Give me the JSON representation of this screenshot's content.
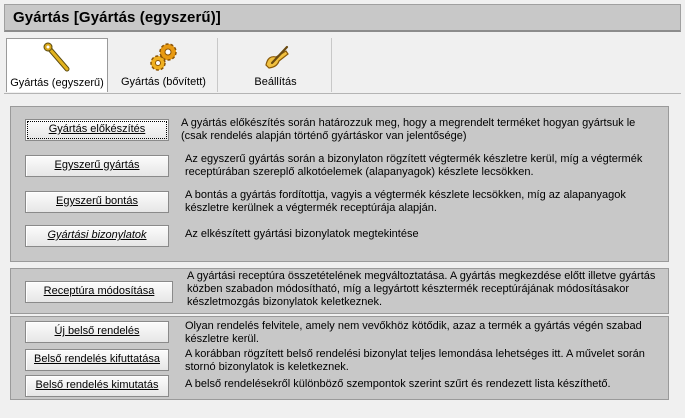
{
  "window": {
    "title": "Gyártás [Gyártás (egyszerű)]"
  },
  "tabs": [
    {
      "label": "Gyártás (egyszerű)",
      "icon": "wrench-icon"
    },
    {
      "label": "Gyártás (bővített)",
      "icon": "gears-icon"
    },
    {
      "label": "Beállítás",
      "icon": "hand-pen-icon"
    }
  ],
  "actions": {
    "prep": {
      "label": "Gyártás előkészítés",
      "desc": "A gyártás előkészítés során határozzuk meg, hogy a megrendelt terméket hogyan gyártsuk le (csak rendelés alapján történő gyártáskor van jelentősége)"
    },
    "simple": {
      "label": "Egyszerű gyártás",
      "desc": "Az egyszerű gyártás során a bizonylaton rögzített végtermék készletre kerül, míg a végtermék receptúrában szereplő alkotóelemek (alapanyagok) készlete lecsökken."
    },
    "breakdown": {
      "label": "Egyszerű bontás",
      "desc": "A bontás a gyártás fordítottja, vagyis a végtermék készlete lecsökken, míg az alapanyagok készletre kerülnek a végtermék receptúrája alapján."
    },
    "documents": {
      "label": "Gyártási bizonylatok",
      "desc": "Az elkészített gyártási bizonylatok megtekintése"
    },
    "recipe": {
      "label": "Receptúra módosítása",
      "desc": "A gyártási receptúra összetételének megváltoztatása. A gyártás megkezdése előtt illetve gyártás közben szabadon módosítható, míg a legyártott késztermék receptúrájának módosításakor készletmozgás bizonylatok keletkeznek."
    },
    "new_order": {
      "label": "Új belső rendelés",
      "desc": "Olyan rendelés felvitele, amely nem vevőkhöz kötődik, azaz a termék a gyártás végén szabad készletre kerül."
    },
    "cancel_order": {
      "label": "Belső rendelés kifuttatása",
      "desc": "A korábban rögzített belső rendelési bizonylat teljes lemondása lehetséges itt. A művelet során stornó bizonylatok is keletkeznek."
    },
    "list_order": {
      "label": "Belső rendelés kimutatás",
      "desc": "A belső rendelésekről különböző szempontok szerint szűrt és rendezett lista készíthető."
    }
  }
}
